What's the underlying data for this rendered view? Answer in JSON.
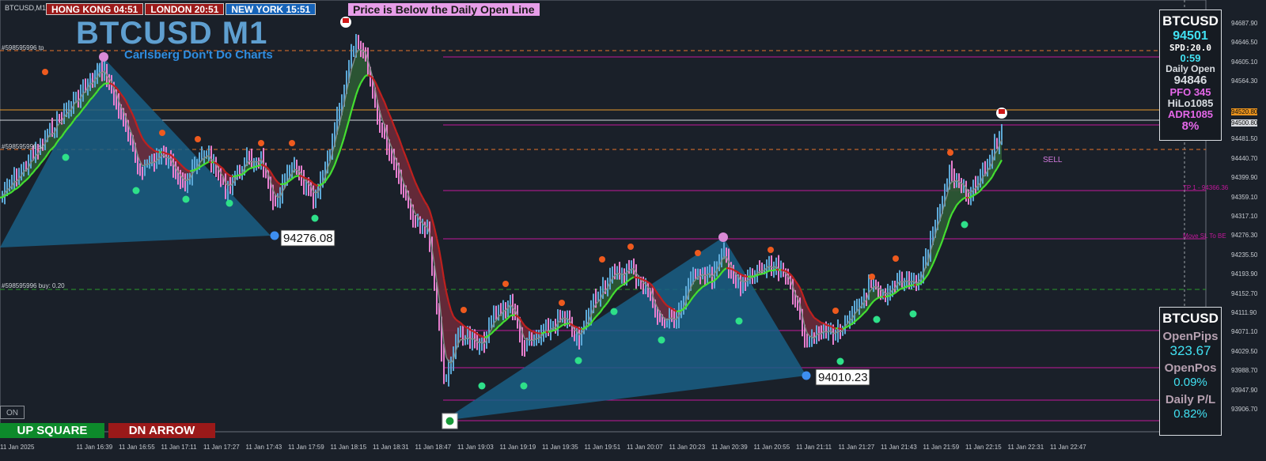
{
  "window": {
    "symbol_label": "BTCUSD,M1"
  },
  "sessions": [
    {
      "label": "HONG KONG 04:51",
      "color": "#9b1919"
    },
    {
      "label": "LONDON  20:51",
      "color": "#9b1919"
    },
    {
      "label": "NEW YORK  15:51",
      "color": "#1663b8"
    }
  ],
  "message": "Price is Below the Daily Open Line",
  "title": "BTCUSD M1",
  "subtitle": "Carlsberg Don't Do Charts",
  "buttons": {
    "up_label": "UP SQUARE",
    "dn_label": "DN ARROW",
    "on_label": "ON"
  },
  "price_labels": {
    "low1": "94276.08",
    "low2": "94010.23"
  },
  "line_labels": {
    "tp": "#598595996 tp",
    "sl": "#598595996 sl",
    "buy": "#598595996 buy: 0.20",
    "sell": "SELL",
    "tp1": "TP 1 - 94366.36",
    "move": "Move SL To BE"
  },
  "info_panel": {
    "symbol": "BTCUSD",
    "bid": "94501",
    "spread": "SPD:20.0",
    "timer": "0:59",
    "daily_open_label": "Daily Open",
    "daily_open": "94846",
    "pfo": "PFO 345",
    "hilo": "HiLo1085",
    "adr": "ADR1085",
    "pct": "8%"
  },
  "pnl_panel": {
    "symbol": "BTCUSD",
    "open_pips_label": "OpenPips",
    "open_pips": "323.67",
    "open_pos_label": "OpenPos",
    "open_pos": "0.09%",
    "daily_pl_label": "Daily P/L",
    "daily_pl": "0.82%"
  },
  "price_axis": [
    "94687.90",
    "94646.50",
    "94605.10",
    "94564.30",
    "94520.80",
    "94500.80",
    "94481.50",
    "94440.70",
    "94399.90",
    "94359.10",
    "94317.10",
    "94276.30",
    "94235.50",
    "94193.90",
    "94152.70",
    "94111.90",
    "94071.10",
    "94029.50",
    "93988.70",
    "93947.90",
    "93906.70"
  ],
  "time_axis": [
    "11 Jan 2025",
    "11 Jan 16:39",
    "11 Jan 16:55",
    "11 Jan 17:11",
    "11 Jan 17:27",
    "11 Jan 17:43",
    "11 Jan 17:59",
    "11 Jan 18:15",
    "11 Jan 18:31",
    "11 Jan 18:47",
    "11 Jan 19:03",
    "11 Jan 19:19",
    "11 Jan 19:35",
    "11 Jan 19:51",
    "11 Jan 20:07",
    "11 Jan 20:23",
    "11 Jan 20:39",
    "11 Jan 20:55",
    "11 Jan 21:11",
    "11 Jan 21:27",
    "11 Jan 21:43",
    "11 Jan 21:59",
    "11 Jan 22:15",
    "11 Jan 22:31",
    "11 Jan 22:47"
  ],
  "colors": {
    "background": "#1a2029",
    "up_bar": "#5ca8d6",
    "down_bar": "#e87fcf",
    "fast_ma": "#7e8b85",
    "slow_ma_up": "#44e030",
    "slow_ma_down": "#c0201e",
    "cloud_up": "#2e5a34",
    "cloud_down": "#6b2a3a",
    "triangle": "#1a5f85"
  }
}
